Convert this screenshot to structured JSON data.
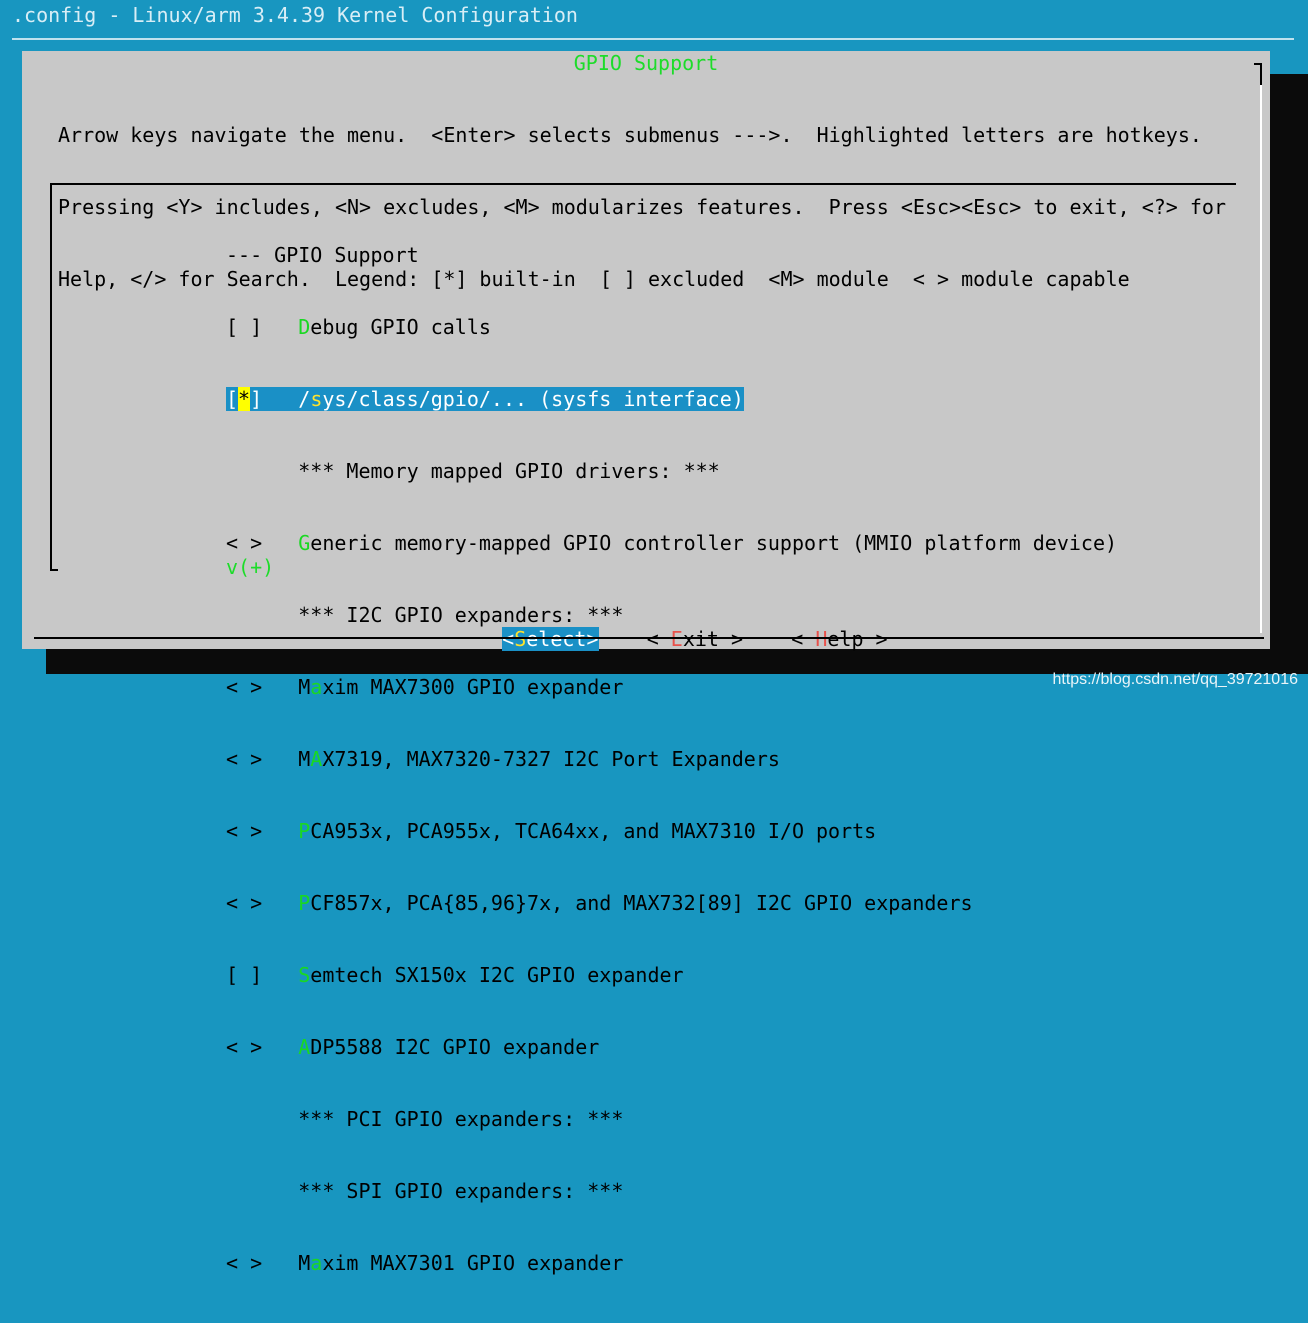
{
  "window": {
    "title": ".config - Linux/arm 3.4.39 Kernel Configuration"
  },
  "dialog": {
    "title": "GPIO Support",
    "help_lines": [
      "Arrow keys navigate the menu.  <Enter> selects submenus --->.  Highlighted letters are hotkeys.",
      "Pressing <Y> includes, <N> excludes, <M> modularizes features.  Press <Esc><Esc> to exit, <?> for",
      "Help, </> for Search.  Legend: [*] built-in  [ ] excluded  <M> module  < > module capable"
    ]
  },
  "menu": {
    "items": [
      {
        "prefix": "--- ",
        "hotkey": "",
        "label": "GPIO Support",
        "selected": false
      },
      {
        "prefix": "[ ]   ",
        "hotkey": "D",
        "label": "ebug GPIO calls",
        "selected": false
      },
      {
        "prefix_open": "[",
        "prefix_mark": "*",
        "prefix_close": "]   /",
        "hotkey": "s",
        "label": "ys/class/gpio/... (sysfs interface)",
        "selected": true
      },
      {
        "prefix": "      ",
        "hotkey": "",
        "label": "*** Memory mapped GPIO drivers: ***",
        "selected": false
      },
      {
        "prefix": "< >   ",
        "hotkey": "G",
        "label": "eneric memory-mapped GPIO controller support (MMIO platform device)",
        "selected": false
      },
      {
        "prefix": "      ",
        "hotkey": "",
        "label": "*** I2C GPIO expanders: ***",
        "selected": false
      },
      {
        "prefix": "< >   M",
        "hotkey": "a",
        "label": "xim MAX7300 GPIO expander",
        "selected": false
      },
      {
        "prefix": "< >   M",
        "hotkey": "A",
        "label": "X7319, MAX7320-7327 I2C Port Expanders",
        "selected": false
      },
      {
        "prefix": "< >   ",
        "hotkey": "P",
        "label": "CA953x, PCA955x, TCA64xx, and MAX7310 I/O ports",
        "selected": false
      },
      {
        "prefix": "< >   ",
        "hotkey": "P",
        "label": "CF857x, PCA{85,96}7x, and MAX732[89] I2C GPIO expanders",
        "selected": false
      },
      {
        "prefix": "[ ]   ",
        "hotkey": "S",
        "label": "emtech SX150x I2C GPIO expander",
        "selected": false
      },
      {
        "prefix": "< >   ",
        "hotkey": "A",
        "label": "DP5588 I2C GPIO expander",
        "selected": false
      },
      {
        "prefix": "      ",
        "hotkey": "",
        "label": "*** PCI GPIO expanders: ***",
        "selected": false
      },
      {
        "prefix": "      ",
        "hotkey": "",
        "label": "*** SPI GPIO expanders: ***",
        "selected": false
      },
      {
        "prefix": "< >   M",
        "hotkey": "a",
        "label": "xim MAX7301 GPIO expander",
        "selected": false
      }
    ],
    "more_indicator": "v(+)"
  },
  "buttons": {
    "select": {
      "open": "<",
      "hotkey": "S",
      "rest": "elect>"
    },
    "exit": {
      "open": "< ",
      "hotkey": "E",
      "rest": "xit >"
    },
    "help": {
      "open": "< ",
      "hotkey": "H",
      "rest": "elp >"
    }
  },
  "watermark": "https://blog.csdn.net/qq_39721016",
  "colors": {
    "background": "#1896c0",
    "dialog": "#c8c8c8",
    "hotkey": "#19d822",
    "selection": "#1a90c6",
    "button_hotkey": "#e8514b"
  }
}
